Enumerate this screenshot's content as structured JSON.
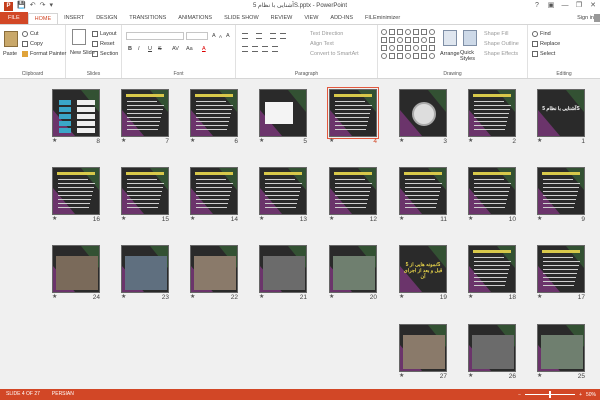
{
  "window": {
    "title": "آشنایی با نظام 5S.pptx - PowerPoint",
    "minimize_glyph": "—",
    "restore_glyph": "❐",
    "close_glyph": "✕",
    "help_glyph": "?",
    "ribbon_opts_glyph": "▣"
  },
  "qat": {
    "save": "💾",
    "undo": "↶",
    "redo": "↷",
    "customize": "▾"
  },
  "tabs": [
    {
      "label": "FILE"
    },
    {
      "label": "HOME"
    },
    {
      "label": "INSERT"
    },
    {
      "label": "DESIGN"
    },
    {
      "label": "TRANSITIONS"
    },
    {
      "label": "ANIMATIONS"
    },
    {
      "label": "SLIDE SHOW"
    },
    {
      "label": "REVIEW"
    },
    {
      "label": "VIEW"
    },
    {
      "label": "ADD-INS"
    },
    {
      "label": "FILEminimizer"
    }
  ],
  "account": {
    "signin": "Sign in"
  },
  "ribbon": {
    "clipboard": {
      "label": "Clipboard",
      "paste": "Paste",
      "cut": "Cut",
      "copy": "Copy",
      "format_painter": "Format Painter"
    },
    "slides": {
      "label": "Slides",
      "new_slide": "New Slide",
      "layout": "Layout",
      "reset": "Reset",
      "section": "Section"
    },
    "font": {
      "label": "Font",
      "bold": "B",
      "italic": "I",
      "underline": "U",
      "strike": "S",
      "grow": "A",
      "shrink": "A",
      "clear": "A",
      "spacing": "AV",
      "case": "Aa",
      "color": "A"
    },
    "paragraph": {
      "label": "Paragraph",
      "text_direction": "Text Direction",
      "align_text": "Align Text",
      "smartart": "Convert to SmartArt"
    },
    "drawing": {
      "label": "Drawing",
      "arrange": "Arrange",
      "quick_styles": "Quick Styles",
      "shape_fill": "Shape Fill",
      "shape_outline": "Shape Outline",
      "shape_effects": "Shape Effects"
    },
    "editing": {
      "label": "Editing",
      "find": "Find",
      "replace": "Replace",
      "select": "Select"
    }
  },
  "slides": [
    {
      "num": "1",
      "star": "★",
      "kind": "title",
      "title": "آشنایی با نظام 5S"
    },
    {
      "num": "2",
      "star": "★",
      "kind": "text"
    },
    {
      "num": "3",
      "star": "★",
      "kind": "flower"
    },
    {
      "num": "4",
      "star": "★",
      "kind": "text",
      "selected": true
    },
    {
      "num": "5",
      "star": "★",
      "kind": "table"
    },
    {
      "num": "6",
      "star": "★",
      "kind": "text"
    },
    {
      "num": "7",
      "star": "★",
      "kind": "text"
    },
    {
      "num": "8",
      "star": "★",
      "kind": "diagram"
    },
    {
      "num": "9",
      "star": "★",
      "kind": "text"
    },
    {
      "num": "10",
      "star": "★",
      "kind": "text"
    },
    {
      "num": "11",
      "star": "★",
      "kind": "text"
    },
    {
      "num": "12",
      "star": "★",
      "kind": "text"
    },
    {
      "num": "13",
      "star": "★",
      "kind": "text"
    },
    {
      "num": "14",
      "star": "★",
      "kind": "text"
    },
    {
      "num": "15",
      "star": "★",
      "kind": "text"
    },
    {
      "num": "16",
      "star": "★",
      "kind": "text"
    },
    {
      "num": "17",
      "star": "★",
      "kind": "text"
    },
    {
      "num": "18",
      "star": "★",
      "kind": "text"
    },
    {
      "num": "19",
      "star": "★",
      "kind": "title2",
      "title": "نمونه هایی از 5S قبل و بعد از اجرای آن"
    },
    {
      "num": "20",
      "star": "★",
      "kind": "photo"
    },
    {
      "num": "21",
      "star": "★",
      "kind": "photo"
    },
    {
      "num": "22",
      "star": "★",
      "kind": "photo"
    },
    {
      "num": "23",
      "star": "★",
      "kind": "photo"
    },
    {
      "num": "24",
      "star": "★",
      "kind": "photo"
    },
    {
      "num": "25",
      "star": "★",
      "kind": "photo"
    },
    {
      "num": "26",
      "star": "★",
      "kind": "photo"
    },
    {
      "num": "27",
      "star": "★",
      "kind": "photo"
    }
  ],
  "statusbar": {
    "slide_of": "SLIDE 4 OF 27",
    "language": "PERSIAN",
    "zoom": "50%",
    "zoom_minus": "−",
    "zoom_plus": "+"
  },
  "colors": {
    "accent": "#d24726",
    "slide_bg": "#2a2a2a",
    "title_yellow": "#d8c84a"
  }
}
